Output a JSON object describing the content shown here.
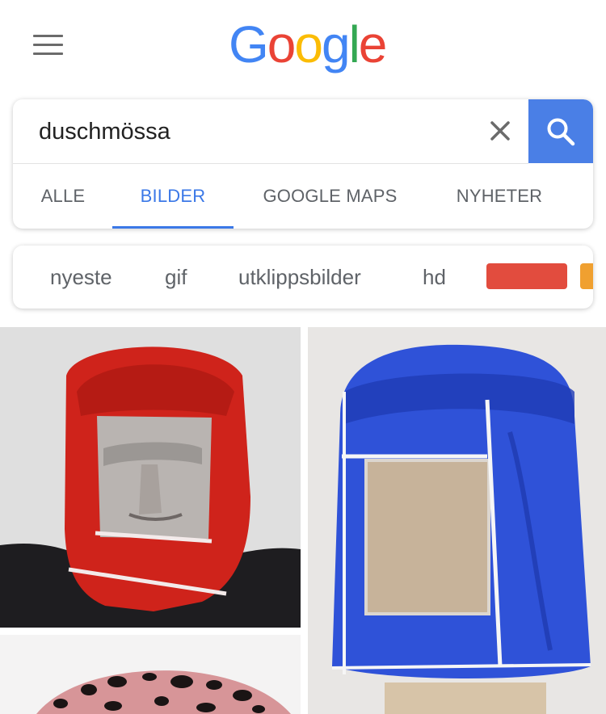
{
  "header": {
    "logo_letters": [
      "G",
      "o",
      "o",
      "g",
      "l",
      "e"
    ],
    "logo_colors": [
      "#4285F4",
      "#EA4335",
      "#FBBC05",
      "#4285F4",
      "#34A853",
      "#EA4335"
    ]
  },
  "search": {
    "query": "duschmössa"
  },
  "tabs": [
    {
      "label": "ALLE"
    },
    {
      "label": "BILDER"
    },
    {
      "label": "GOOGLE MAPS"
    },
    {
      "label": "NYHETER"
    }
  ],
  "active_tab": "BILDER",
  "chips": [
    {
      "label": "nyeste"
    },
    {
      "label": "gif"
    },
    {
      "label": "utklippsbilder"
    },
    {
      "label": "hd"
    }
  ],
  "color_swatches": [
    "#e24c3e",
    "#f0a030"
  ],
  "colors": {
    "accent": "#3b78e7",
    "search_button": "#4a7fe6"
  },
  "images": [
    {
      "icon": "red-hood-with-face-window-photo"
    },
    {
      "icon": "blue-hood-cover-on-mannequin-photo"
    },
    {
      "icon": "pink-spotted-shower-cap-photo"
    }
  ]
}
